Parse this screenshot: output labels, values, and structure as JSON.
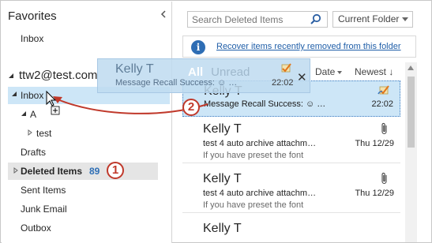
{
  "nav": {
    "favorites_title": "Favorites",
    "favorites_inbox": "Inbox",
    "account": "ttw2@test.com",
    "inbox": "Inbox",
    "folder_a": "A",
    "folder_test": "test",
    "drafts": "Drafts",
    "deleted_items": "Deleted Items",
    "deleted_count": "89",
    "sent_items": "Sent Items",
    "junk_email": "Junk Email",
    "outbox": "Outbox"
  },
  "steps": {
    "one": "1",
    "two": "2"
  },
  "search": {
    "placeholder": "Search Deleted Items",
    "scope": "Current Folder"
  },
  "recover": {
    "link": "Recover items recently removed from this folder"
  },
  "sort": {
    "by": "Date",
    "order": "Newest"
  },
  "ghost": {
    "sender": "Kelly T",
    "tab_all": "All",
    "tab_unread": "Unread",
    "subject": "Message Recall Success: ☺ …",
    "time": "22:02",
    "close": "✕"
  },
  "mails": [
    {
      "sender": "Kelly T",
      "subject": "Message Recall Success: ☺ …",
      "preview": "",
      "date": "22:02"
    },
    {
      "sender": "Kelly T",
      "subject": "test 4 auto archive attachm…",
      "preview": "If you have preset the font",
      "date": "Thu 12/29"
    },
    {
      "sender": "Kelly T",
      "subject": "test 4 auto archive attachm…",
      "preview": "If you have preset the font",
      "date": "Thu 12/29"
    },
    {
      "sender": "Kelly T",
      "subject": "",
      "preview": "",
      "date": ""
    }
  ],
  "colors": {
    "accent": "#2e6db4",
    "selection": "#cde6f7",
    "step_badge": "#c0392b"
  }
}
